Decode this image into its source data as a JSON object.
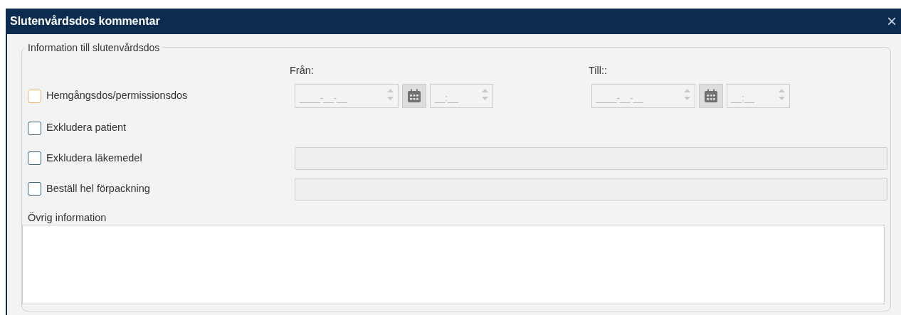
{
  "window": {
    "title": "Slutenvårdsdos kommentar",
    "close": "×"
  },
  "group": {
    "legend": "Information till slutenvårdsdos"
  },
  "range": [
    {
      "label": "Från:",
      "date": {
        "placeholder": "____-__-__",
        "disabled": true
      },
      "time": {
        "placeholder": "__:__",
        "disabled": true
      }
    },
    {
      "label": "Till::",
      "date": {
        "placeholder": "____-__-__",
        "disabled": true
      },
      "time": {
        "placeholder": "__:__",
        "disabled": true
      }
    }
  ],
  "options": [
    {
      "label": "Hemgångsdos/permissionsdos",
      "checked": false,
      "focused": true,
      "kind": "range"
    },
    {
      "label": "Exkludera patient",
      "checked": false,
      "focused": false,
      "kind": "plain"
    },
    {
      "label": "Exkludera läkemedel",
      "checked": false,
      "focused": false,
      "kind": "text",
      "field": {
        "disabled": true
      }
    },
    {
      "label": "Beställ hel förpackning",
      "checked": false,
      "focused": false,
      "kind": "text",
      "field": {
        "disabled": true
      }
    }
  ],
  "other": {
    "label": "Övrig information"
  }
}
